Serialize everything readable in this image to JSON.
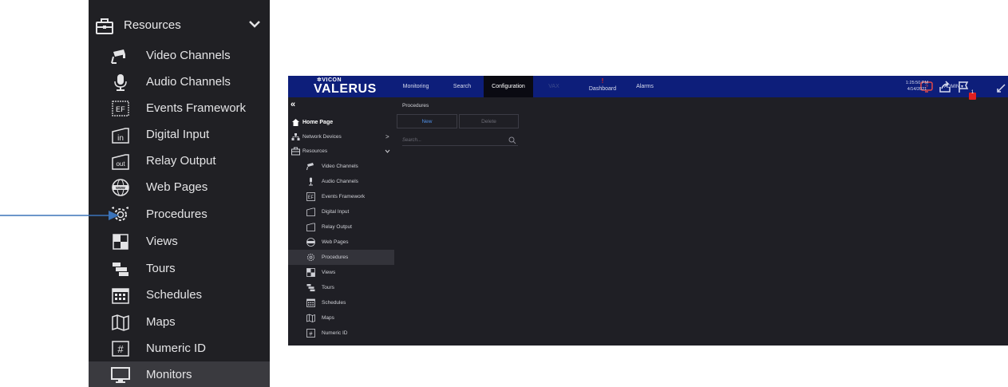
{
  "zoom_sidebar": {
    "header": {
      "label": "Resources",
      "icon": "briefcase-icon"
    },
    "items": [
      {
        "label": "Video Channels",
        "icon": "camera-icon"
      },
      {
        "label": "Audio Channels",
        "icon": "microphone-icon"
      },
      {
        "label": "Events Framework",
        "icon": "events-framework-icon",
        "icon_text": "EF"
      },
      {
        "label": "Digital Input",
        "icon": "digital-input-icon",
        "icon_text": "in"
      },
      {
        "label": "Relay Output",
        "icon": "relay-output-icon",
        "icon_text": "out"
      },
      {
        "label": "Web Pages",
        "icon": "globe-icon",
        "icon_text": "www"
      },
      {
        "label": "Procedures",
        "icon": "procedures-gear-icon"
      },
      {
        "label": "Views",
        "icon": "views-grid-icon"
      },
      {
        "label": "Tours",
        "icon": "tours-icon"
      },
      {
        "label": "Schedules",
        "icon": "calendar-icon"
      },
      {
        "label": "Maps",
        "icon": "map-icon"
      },
      {
        "label": "Numeric ID",
        "icon": "numeric-id-icon",
        "icon_text": "#"
      },
      {
        "label": "Monitors",
        "icon": "monitor-icon"
      }
    ]
  },
  "app": {
    "brand": {
      "small": "VICON",
      "name": "VALERUS"
    },
    "nav": {
      "monitoring": "Monitoring",
      "search": "Search",
      "configuration": "Configuration",
      "vax": "VAX",
      "dashboard": "Dashboard",
      "dashboard_alert": "!",
      "alarms": "Alarms"
    },
    "status": {
      "time": "1:25:50 PM",
      "date": "4/14/2021",
      "user": "ADMIN ▾",
      "flag_count": "1"
    },
    "left_panel": {
      "collapse": "«",
      "home": "Home Page",
      "network_devices": "Network Devices",
      "resources": "Resources",
      "items": [
        "Video Channels",
        "Audio Channels",
        "Events Framework",
        "Digital Input",
        "Relay Output",
        "Web Pages",
        "Procedures",
        "Views",
        "Tours",
        "Schedules",
        "Maps",
        "Numeric ID"
      ]
    },
    "main": {
      "breadcrumb": "Procedures",
      "new_button": "New",
      "delete_button": "Delete",
      "search_placeholder": "Search..."
    }
  },
  "colors": {
    "topbar": "#0d1e7a",
    "dark_bg": "#1f1f25",
    "zoom_bg": "#202024",
    "arrow": "#3b73b9",
    "alert": "#e02020"
  }
}
